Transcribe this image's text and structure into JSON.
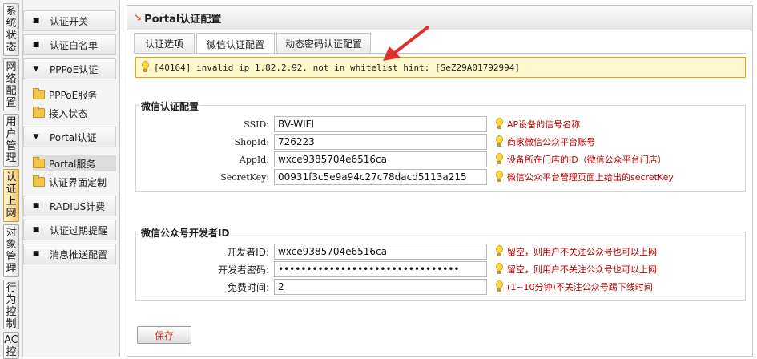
{
  "vertical_tabs": [
    "系统状态",
    "网络配置",
    "用户管理",
    "认证上网",
    "对象管理",
    "行为控制",
    "AC控制"
  ],
  "menu": {
    "items": [
      {
        "label": "认证开关",
        "glyph": "■"
      },
      {
        "label": "认证白名单",
        "glyph": "■"
      },
      {
        "label": "PPPoE认证",
        "glyph": "▼"
      },
      {
        "label": "Portal认证",
        "glyph": "▼"
      },
      {
        "label": "RADIUS计费",
        "glyph": "■"
      },
      {
        "label": "认证过期提醒",
        "glyph": "■"
      },
      {
        "label": "消息推送配置",
        "glyph": "■"
      }
    ],
    "sub_items": [
      "PPPoE服务",
      "接入状态",
      "Portal服务",
      "认证界面定制"
    ]
  },
  "panel": {
    "title": "Portal认证配置"
  },
  "tabs": [
    "认证选项",
    "微信认证配置",
    "动态密码认证配置"
  ],
  "alert": "[40164] invalid ip 1.82.2.92. not in whitelist hint: [SeZ29A01792994]",
  "wechat": {
    "title": "微信认证配置",
    "fields": [
      {
        "label": "SSID:",
        "value": "BV-WIFI",
        "hint": "AP设备的信号名称"
      },
      {
        "label": "ShopId:",
        "value": "726223",
        "hint": "商家微信公众平台账号"
      },
      {
        "label": "AppId:",
        "value": "wxce9385704e6516ca",
        "hint": "设备所在门店的ID（微信公众平台门店）"
      },
      {
        "label": "SecretKey:",
        "value": "00931f3c5e9a94c27c78dacd5113a215",
        "hint": "微信公众平台管理页面上给出的secretKey"
      }
    ]
  },
  "developer": {
    "title": "微信公众号开发者ID",
    "fields": [
      {
        "label": "开发者ID:",
        "value": "wxce9385704e6516ca",
        "hint": "留空，则用户不关注公众号也可以上网"
      },
      {
        "label": "开发者密码:",
        "value": "••••••••••••••••••••••••••••••••",
        "hint": "留空，则用户不关注公众号也可以上网"
      },
      {
        "label": "免费时间:",
        "value": "2",
        "hint": "(1~10分钟)不关注公众号踢下线时间"
      }
    ]
  },
  "save_label": "保存",
  "colors": {
    "accent": "#c00000",
    "alert_bg": "#fff8cc",
    "alert_border": "#e0a800",
    "annotation_arrow": "#e0302a"
  }
}
